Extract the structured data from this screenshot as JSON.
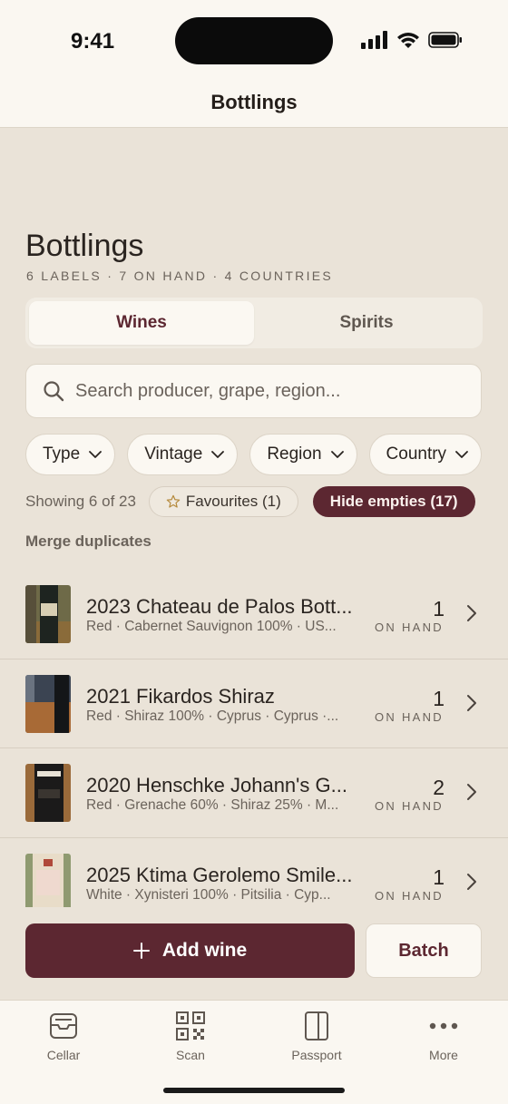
{
  "status": {
    "time": "9:41"
  },
  "nav": {
    "title": "Bottlings"
  },
  "header": {
    "title": "Bottlings",
    "subtitle": "6 labels · 7 on hand · 4 countries"
  },
  "segments": [
    {
      "label": "Wines",
      "active": true
    },
    {
      "label": "Spirits",
      "active": false
    }
  ],
  "search": {
    "placeholder": "Search producer, grape, region...",
    "value": ""
  },
  "filters": [
    {
      "label": "Type"
    },
    {
      "label": "Vintage"
    },
    {
      "label": "Region"
    },
    {
      "label": "Country"
    }
  ],
  "meta": {
    "showing": "Showing 6 of 23",
    "favourites": "Favourites (1)",
    "hide_empties": "Hide empties (17)",
    "merge": "Merge duplicates"
  },
  "wines": [
    {
      "title": "2023 Chateau de Palos Bott...",
      "subtitle": "Red · Cabernet Sauvignon 100% · US...",
      "count": "1",
      "unit": "ON HAND"
    },
    {
      "title": "2021 Fikardos Shiraz",
      "subtitle": "Red · Shiraz 100% · Cyprus · Cyprus ·...",
      "count": "1",
      "unit": "ON HAND"
    },
    {
      "title": "2020 Henschke Johann's G...",
      "subtitle": "Red · Grenache 60% · Shiraz 25% · M...",
      "count": "2",
      "unit": "ON HAND"
    },
    {
      "title": "2025 Ktima Gerolemo Smile...",
      "subtitle": "White · Xynisteri 100% · Pitsilia · Cyp...",
      "count": "1",
      "unit": "ON HAND"
    }
  ],
  "actions": {
    "add": "Add wine",
    "batch": "Batch"
  },
  "tabs": [
    {
      "label": "Cellar"
    },
    {
      "label": "Scan"
    },
    {
      "label": "Passport"
    },
    {
      "label": "More"
    }
  ],
  "colors": {
    "accent": "#5C2731",
    "background": "#EAE3D8",
    "surface": "#FBF8F2"
  }
}
